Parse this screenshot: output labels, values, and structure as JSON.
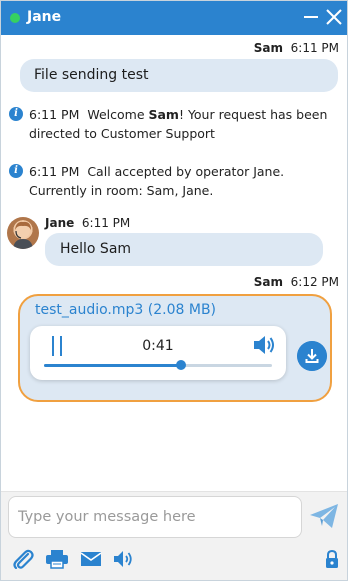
{
  "header": {
    "title": "Jane",
    "status": "online",
    "status_color": "#36d061",
    "accent": "#2b83cf"
  },
  "messages": {
    "m1": {
      "sender": "Sam",
      "time": "6:11 PM",
      "text": "File sending test"
    },
    "sys1": {
      "time": "6:11 PM",
      "before": "Welcome ",
      "name": "Sam",
      "after": "! Your request has been directed to Customer Support"
    },
    "sys2": {
      "time": "6:11 PM",
      "text": "Call accepted by operator Jane. Currently in room: Sam, Jane."
    },
    "m2": {
      "sender": "Jane",
      "time": "6:11 PM",
      "text": "Hello Sam"
    },
    "m3": {
      "sender": "Sam",
      "time": "6:12 PM",
      "file": {
        "name": "test_audio.mp3",
        "size": "(2.08 MB)",
        "elapsed": "0:41",
        "progress": 0.6,
        "highlight_color": "#f0a040"
      }
    }
  },
  "composer": {
    "placeholder": "Type your message here",
    "value": "",
    "tools": [
      "paperclip-icon",
      "printer-icon",
      "envelope-icon",
      "speaker-icon",
      "lock-icon"
    ]
  }
}
